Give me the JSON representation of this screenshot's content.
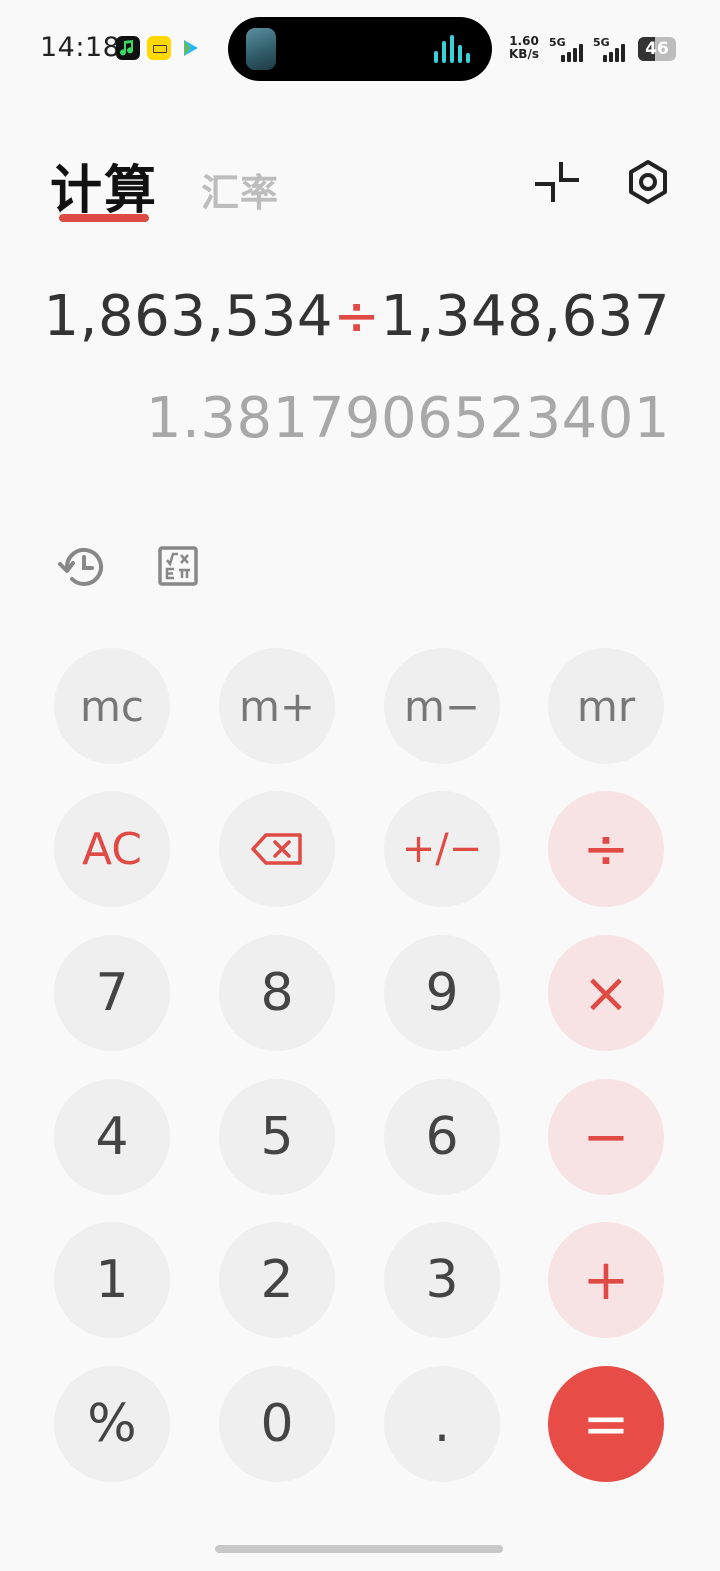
{
  "status_bar": {
    "time": "14:18",
    "net_speed_value": "1.60",
    "net_speed_unit": "KB/s",
    "sim1_label": "5G",
    "sim2_label": "5G",
    "battery_level": "46",
    "battery_fraction": 0.46
  },
  "header": {
    "tabs": [
      {
        "label": "计算",
        "active": true
      },
      {
        "label": "汇率",
        "active": false
      }
    ],
    "split_icon": "split-screen-icon",
    "settings_icon": "gear-icon"
  },
  "display": {
    "operand1": "1,863,534",
    "operator": "÷",
    "operand2": "1,348,637",
    "result": "1.3817906523401"
  },
  "tools": {
    "history_icon": "history-icon",
    "scientific_icon": "scientific-calculator-icon"
  },
  "keypad": {
    "mc": "mc",
    "mplus": "m+",
    "mminus": "m−",
    "mr": "mr",
    "ac": "AC",
    "backspace_icon": "backspace-icon",
    "sign": "+/−",
    "divide": "÷",
    "seven": "7",
    "eight": "8",
    "nine": "9",
    "multiply": "×",
    "four": "4",
    "five": "5",
    "six": "6",
    "minus": "−",
    "one": "1",
    "two": "2",
    "three": "3",
    "plus": "+",
    "percent": "%",
    "zero": "0",
    "dot": ".",
    "equals": "="
  },
  "colors": {
    "accent": "#e04a45",
    "operator_key_bg": "#f7e3e3",
    "key_bg": "#efefef",
    "background": "#f9f9f9"
  }
}
